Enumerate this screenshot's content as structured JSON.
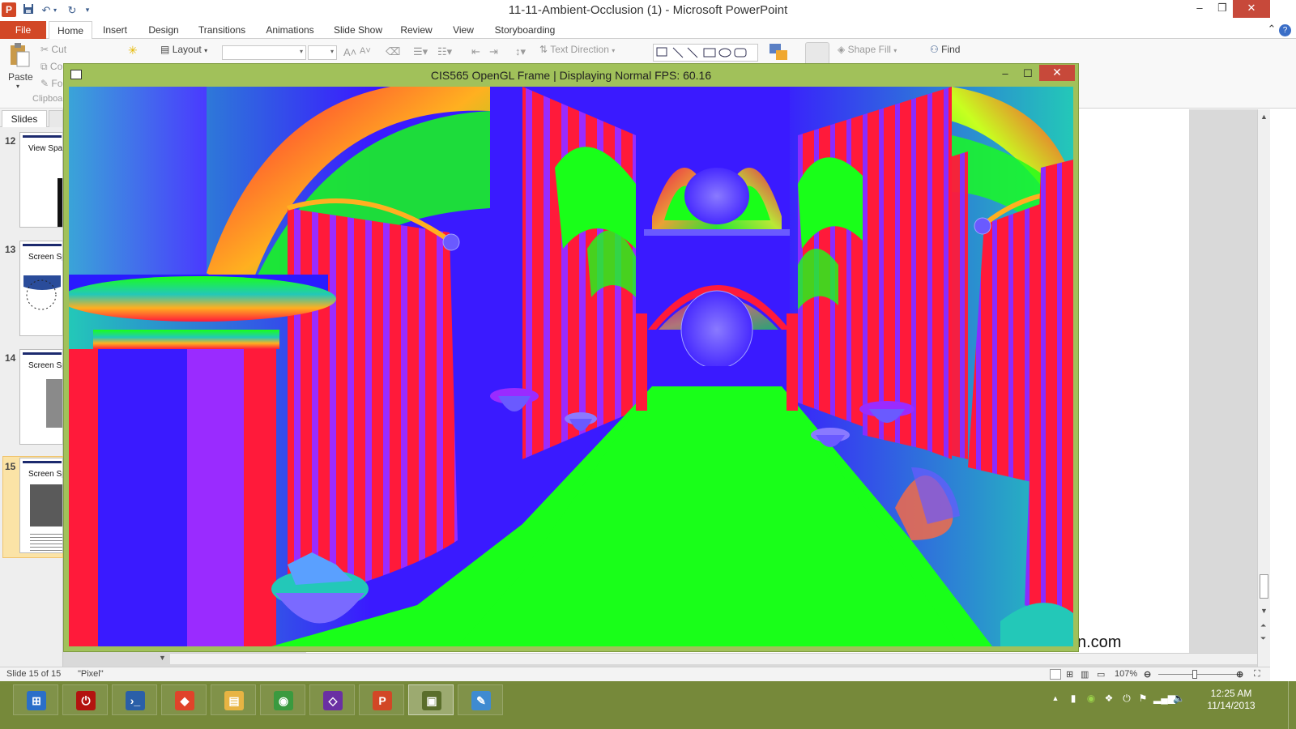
{
  "powerpoint": {
    "window_title": "11-11-Ambient-Occlusion (1)  -  Microsoft PowerPoint",
    "app_icon_letter": "P",
    "qat": {
      "save_icon": "save-icon",
      "undo_icon": "undo-icon",
      "redo_icon": "redo-icon"
    },
    "window_controls": {
      "minimize": "–",
      "restore": "❐",
      "close": "✕"
    },
    "tabs": [
      "File",
      "Home",
      "Insert",
      "Design",
      "Transitions",
      "Animations",
      "Slide Show",
      "Review",
      "View",
      "Storyboarding"
    ],
    "active_tab": "Home",
    "ribbon": {
      "paste": "Paste",
      "cut": "Cut",
      "copy_partial": "Co",
      "format_painter_partial": "Fo",
      "clipboard_group": "Clipboa",
      "layout": "Layout",
      "text_direction": "Text Direction",
      "shape_fill": "Shape Fill",
      "find": "Find"
    },
    "slide_pane": {
      "tab_label": "Slides",
      "thumbnails": [
        {
          "num": "12",
          "title": "View Spa"
        },
        {
          "num": "13",
          "title": "Screen Sp"
        },
        {
          "num": "14",
          "title": "Screen Sp"
        },
        {
          "num": "15",
          "title": "Screen Sp"
        }
      ],
      "selected": "15"
    },
    "slide_url_fragment": "n.com",
    "status": {
      "slide_info": "Slide 15 of 15",
      "theme": "\"Pixel\"",
      "zoom": "107%",
      "zoom_level": 0.47
    }
  },
  "gl_window": {
    "title": "CIS565 OpenGL Frame | Displaying Normal FPS: 60.16",
    "controls": {
      "minimize": "–",
      "maximize": "☐",
      "close": "✕"
    },
    "colors": {
      "red": "#ff1a3a",
      "green": "#19ff19",
      "blue": "#3a1aff",
      "purple": "#9a2bff",
      "teal": "#23c8b8"
    }
  },
  "taskbar": {
    "apps": [
      {
        "name": "windows-start",
        "glyph": "⊞",
        "color": "#2a6fc9"
      },
      {
        "name": "power-button",
        "glyph": "⏻",
        "color": "#b3130f"
      },
      {
        "name": "powershell",
        "glyph": "›_",
        "color": "#2a5fa8"
      },
      {
        "name": "git",
        "glyph": "◆",
        "color": "#e0432a"
      },
      {
        "name": "file-explorer",
        "glyph": "▤",
        "color": "#e8b443"
      },
      {
        "name": "chrome",
        "glyph": "◉",
        "color": "#3a9a3f"
      },
      {
        "name": "visual-studio",
        "glyph": "◇",
        "color": "#6a2fa3"
      },
      {
        "name": "powerpoint",
        "glyph": "P",
        "color": "#d24726"
      },
      {
        "name": "opengl-frame",
        "glyph": "▣",
        "color": "#5a6e2b"
      },
      {
        "name": "paint",
        "glyph": "✎",
        "color": "#3f8bd1"
      }
    ],
    "clock_time": "12:25 AM",
    "clock_date": "11/14/2013"
  }
}
